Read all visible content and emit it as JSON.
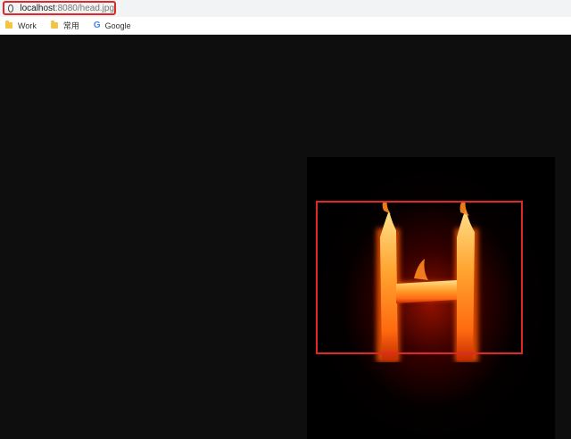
{
  "address_bar": {
    "url_host": "localhost",
    "url_rest": ":8080/head.jpg"
  },
  "bookmarks": [
    {
      "label": "Work",
      "icon": "folder-icon"
    },
    {
      "label": "常用",
      "icon": "folder-icon"
    },
    {
      "label": "Google",
      "icon": "google-icon"
    }
  ],
  "image": {
    "letter": "H",
    "highlight_color": "#e0282a"
  }
}
